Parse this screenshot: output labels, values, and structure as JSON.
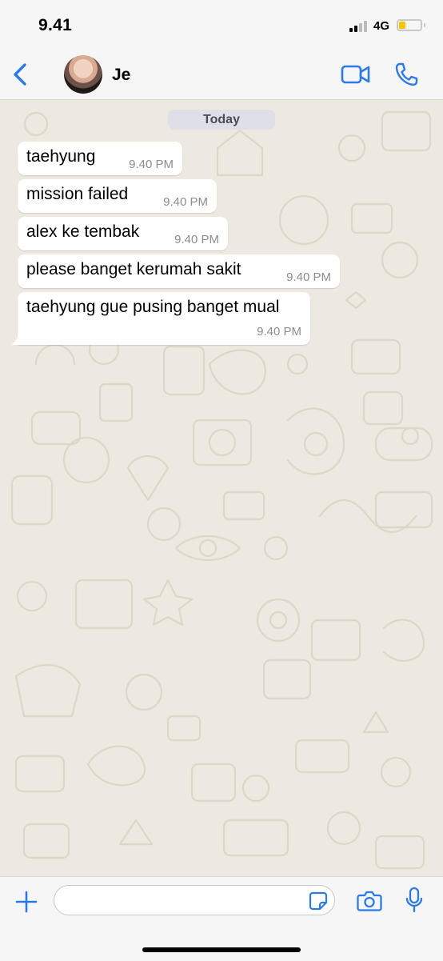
{
  "status_bar": {
    "time": "9.41",
    "network": "4G",
    "battery_color": "#f7c600"
  },
  "header": {
    "contact_name": "Je",
    "back_icon": "chevron-left-icon",
    "video_icon": "video-camera-icon",
    "call_icon": "phone-icon",
    "accent_color": "#2c7be5"
  },
  "chat": {
    "date_label": "Today",
    "messages": [
      {
        "text": "taehyung",
        "time": "9.40 PM"
      },
      {
        "text": "mission failed",
        "time": "9.40 PM"
      },
      {
        "text": "alex ke tembak",
        "time": "9.40 PM"
      },
      {
        "text": "please banget kerumah sakit",
        "time": "9.40 PM"
      },
      {
        "text": "taehyung gue pusing banget mual",
        "time": "9.40 PM"
      }
    ]
  },
  "input_bar": {
    "placeholder": "",
    "icons": [
      "plus-icon",
      "sticker-icon",
      "camera-icon",
      "microphone-icon"
    ]
  }
}
